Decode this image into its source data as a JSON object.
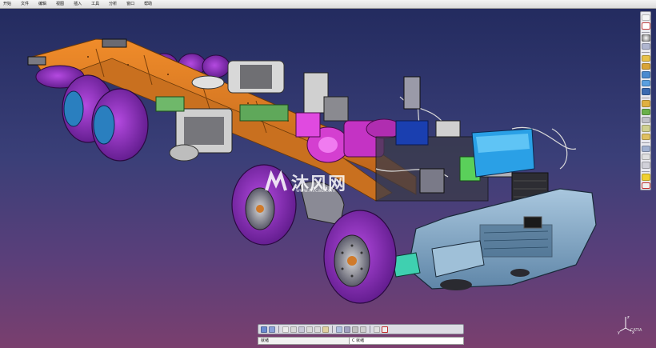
{
  "menu": {
    "items": [
      "开始",
      "文件",
      "编辑",
      "视图",
      "插入",
      "工具",
      "分析",
      "窗口",
      "帮助"
    ]
  },
  "watermark": {
    "text": "沐风网",
    "url": "www.mfcad.com"
  },
  "command_bar": {
    "status": "就绪",
    "placeholder": "C 就绪"
  },
  "compass": {
    "z_label": "z",
    "y_label": "y",
    "x_label": "x"
  },
  "branding": {
    "logo_text": "CATIA"
  },
  "colors": {
    "background_top": "#222a5e",
    "background_bottom": "#7a3f6e",
    "chassis_frame": "#e07a1f",
    "wheels": "#9b2fc9",
    "cab_front": "#7fa8c9",
    "radiator": "#2aa0e6",
    "engine": "#d43fd0"
  },
  "icons": {
    "right_toolbar": [
      "select-icon",
      "sketch-icon",
      "sep",
      "sphere-icon",
      "cube-icon",
      "sep",
      "part-icon",
      "pad-icon",
      "pocket-icon",
      "shaft-icon",
      "hole-icon",
      "sep",
      "fillet-icon",
      "chamfer-icon",
      "draft-icon",
      "shell-icon",
      "thickness-icon",
      "sep",
      "plane-icon",
      "point-icon",
      "line-icon",
      "sep",
      "light-icon",
      "measure-icon"
    ],
    "bottom_toolbar": [
      "fly-icon",
      "walk-icon",
      "sep",
      "fit-all-icon",
      "pan-icon",
      "rotate-icon",
      "zoom-in-icon",
      "zoom-out-icon",
      "normal-view-icon",
      "sep",
      "iso-view-icon",
      "shading-icon",
      "hide-show-icon",
      "swap-icon",
      "sep",
      "view-mode-icon",
      "properties-icon"
    ]
  }
}
